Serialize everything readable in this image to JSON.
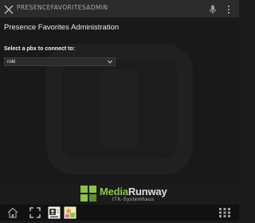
{
  "header": {
    "app_title": "PRESENCEFAVORITESADMIN"
  },
  "main": {
    "page_title": "Presence Favorites Administration",
    "pbx_label": "Select a pbx to connect to:",
    "pbx_selected": "roki"
  },
  "branding": {
    "name_accent": "Media",
    "name_rest": "Runway",
    "subtitle": "ITK-Systemhaus",
    "accent_color": "#8cc63f"
  },
  "taskbar": {
    "icons": [
      "home-icon",
      "expand-icon",
      "contacts-icon",
      "app-icon",
      "grid-menu-icon"
    ]
  }
}
